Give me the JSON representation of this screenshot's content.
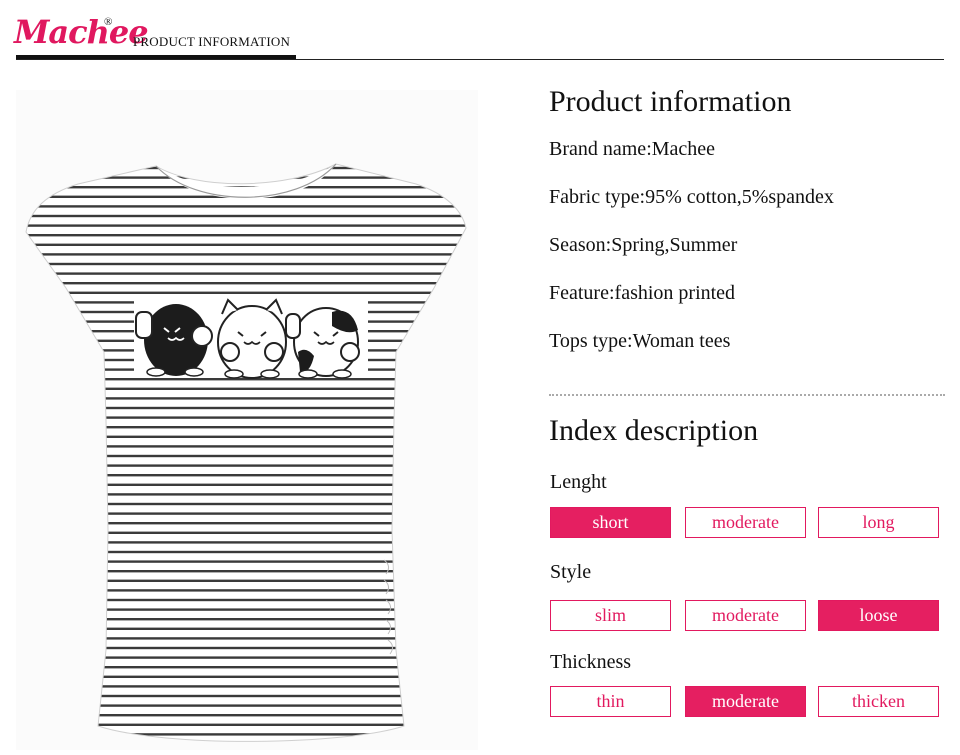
{
  "header": {
    "brand_logo": "Machee",
    "registered_mark": "®",
    "label": "PRODUCT INFORMATION"
  },
  "product_image": {
    "subject": "Striped cap-sleeve tee with three cat print"
  },
  "product_info": {
    "title": "Product information",
    "lines": [
      "Brand name:Machee",
      "Fabric type:95% cotton,5%spandex",
      "Season:Spring,Summer",
      "Feature:fashion printed",
      "Tops type:Woman tees"
    ]
  },
  "index": {
    "title": "Index description",
    "groups": [
      {
        "label": "Lenght",
        "options": [
          "short",
          "moderate",
          "long"
        ],
        "selected": "short"
      },
      {
        "label": "Style",
        "options": [
          "slim",
          "moderate",
          "loose"
        ],
        "selected": "loose"
      },
      {
        "label": "Thickness",
        "options": [
          "thin",
          "moderate",
          "thicken"
        ],
        "selected": "moderate"
      }
    ]
  },
  "colors": {
    "accent": "#e51f61",
    "text": "#111111"
  }
}
